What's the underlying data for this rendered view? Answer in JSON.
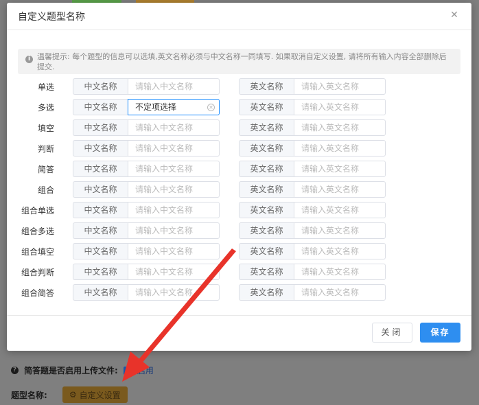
{
  "dialog": {
    "title": "自定义题型名称",
    "tip": "温馨提示: 每个题型的信息可以选填,英文名称必须与中文名称一同填写. 如果取消自定义设置, 请将所有输入内容全部删除后提交.",
    "cn_addon": "中文名称",
    "en_addon": "英文名称",
    "cn_placeholder": "请输入中文名称",
    "en_placeholder": "请输入英文名称",
    "rows": [
      {
        "label": "单选",
        "cn_value": "",
        "en_value": ""
      },
      {
        "label": "多选",
        "cn_value": "不定项选择",
        "en_value": ""
      },
      {
        "label": "填空",
        "cn_value": "",
        "en_value": ""
      },
      {
        "label": "判断",
        "cn_value": "",
        "en_value": ""
      },
      {
        "label": "简答",
        "cn_value": "",
        "en_value": ""
      },
      {
        "label": "组合",
        "cn_value": "",
        "en_value": ""
      },
      {
        "label": "组合单选",
        "cn_value": "",
        "en_value": ""
      },
      {
        "label": "组合多选",
        "cn_value": "",
        "en_value": ""
      },
      {
        "label": "组合填空",
        "cn_value": "",
        "en_value": ""
      },
      {
        "label": "组合判断",
        "cn_value": "",
        "en_value": ""
      },
      {
        "label": "组合简答",
        "cn_value": "",
        "en_value": ""
      }
    ],
    "close_label": "关闭",
    "save_label": "保存"
  },
  "background": {
    "upload_question": "简答题是否启用上传文件:",
    "enable_label": "启用",
    "type_name_label": "题型名称:",
    "custom_settings_label": "自定义设置"
  },
  "colors": {
    "primary": "#2e8ef0",
    "annotation_arrow": "#e8332a",
    "custom_button_bg": "#7a5a1e"
  }
}
